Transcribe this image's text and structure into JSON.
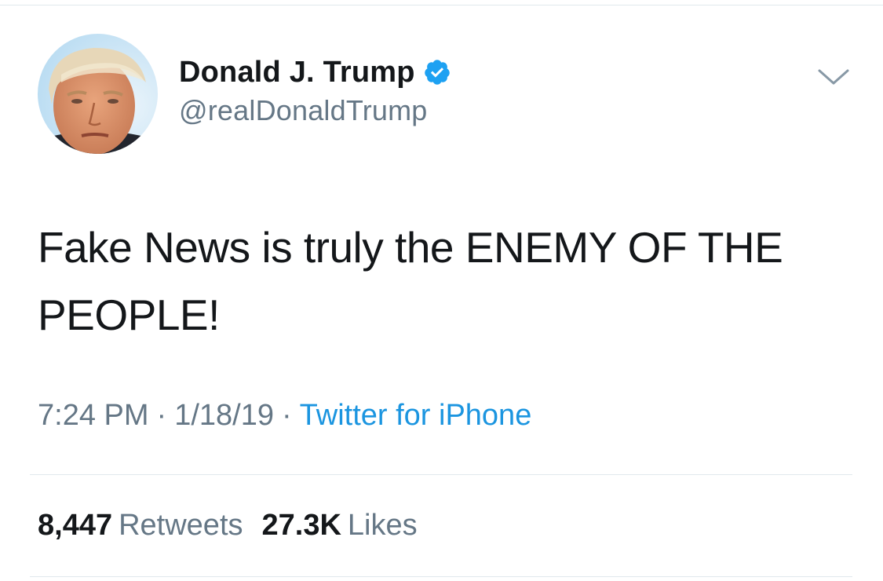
{
  "colors": {
    "text_primary": "#14171a",
    "text_secondary": "#657786",
    "link": "#1b95e0",
    "verified_badge": "#1da1f2",
    "divider": "#e1e8ed"
  },
  "tweet": {
    "author": {
      "display_name": "Donald J. Trump",
      "handle": "@realDonaldTrump",
      "verified_icon": "verified-badge-icon",
      "avatar": "profile-photo"
    },
    "menu_icon": "chevron-down-icon",
    "text_line1": "Fake News is truly the ENEMY OF THE",
    "text_line2": "PEOPLE!",
    "time": "7:24 PM",
    "separator": "·",
    "date": "1/18/19",
    "source": "Twitter for iPhone",
    "retweets": {
      "count": "8,447",
      "label": "Retweets"
    },
    "likes": {
      "count": "27.3K",
      "label": "Likes"
    }
  }
}
